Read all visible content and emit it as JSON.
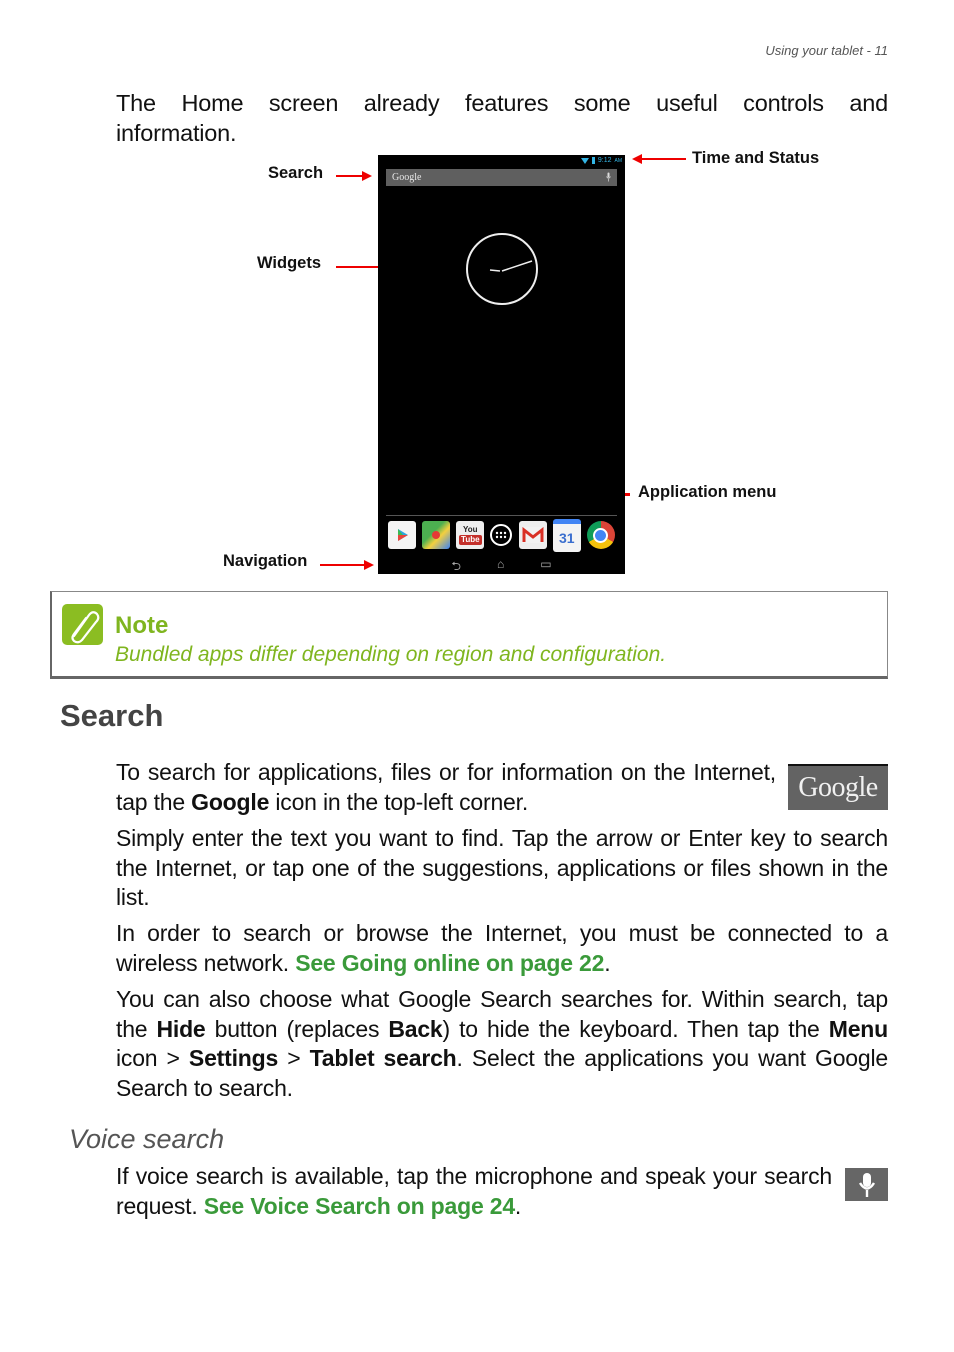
{
  "header": {
    "running_title": "Using your tablet - 11"
  },
  "intro": {
    "line1": "The Home screen already features some useful controls and",
    "line2": "information."
  },
  "figure": {
    "labels": {
      "search": "Search",
      "widgets": "Widgets",
      "time_status": "Time and Status",
      "app_menu": "Application menu",
      "navigation": "Navigation"
    },
    "tablet": {
      "status_time": "9:12",
      "status_ampm": "AM",
      "search_bar_text": "Google",
      "dock_apps": [
        "Play Store",
        "Maps",
        "YouTube",
        "Apps",
        "Gmail",
        "Calendar",
        "Chrome"
      ],
      "youtube_top": "You",
      "youtube_bottom": "Tube",
      "calendar_day": "31",
      "nav_buttons": [
        "back",
        "home",
        "recent-apps"
      ],
      "nav_glyphs": [
        "⮌",
        "⌂",
        "▭"
      ]
    }
  },
  "note": {
    "title": "Note",
    "text": "Bundled apps differ depending on region and configuration.",
    "accent_color": "#7fb51f"
  },
  "sections": {
    "search": {
      "heading": "Search",
      "p1_a": "To search for applications, files or for information on the Internet, tap the ",
      "p1_bold": "Google",
      "p1_b": "  icon in the top-left corner.",
      "google_icon_text": "Google",
      "p2": "Simply enter the text you want to find. Tap the arrow or Enter key to search the Internet, or tap one of the suggestions, applications or files shown in the list.",
      "p3_a": "In order to search or browse the Internet, you must be connected to a wireless network. ",
      "p3_link": "See Going online on page 22",
      "p3_b": ".",
      "p4_a": "You can also choose what Google Search searches for. Within search, tap the ",
      "p4_hide": "Hide",
      "p4_b": " button (replaces ",
      "p4_back": "Back",
      "p4_c": ") to hide the keyboard. Then tap the ",
      "p4_menu": "Menu",
      "p4_d": " icon > ",
      "p4_settings": "Settings",
      "p4_e": " > ",
      "p4_tablet": "Tablet search",
      "p4_f": ". Select the applications you want Google Search to search."
    },
    "voice": {
      "heading": "Voice search",
      "p1_a": "If voice search is available, tap the microphone and speak your search request. ",
      "p1_link": "See Voice Search on page 24",
      "p1_b": "."
    }
  }
}
